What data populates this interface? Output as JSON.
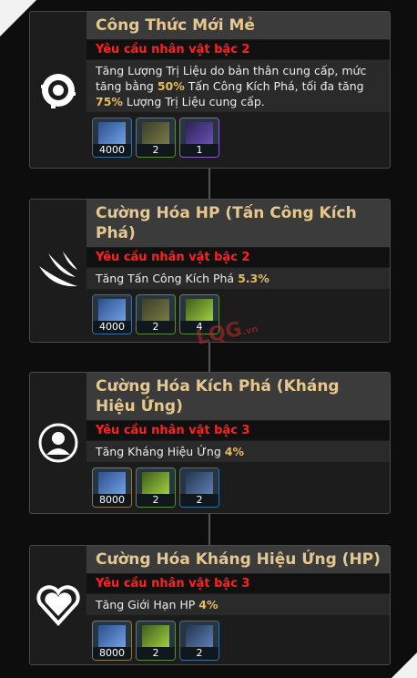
{
  "cards": [
    {
      "title": "Công Thức Mới Mẻ",
      "requirement": "Yêu cầu nhân vật bậc 2",
      "desc": {
        "t1": "Tăng Lượng Trị Liệu do bản thân cung cấp, mức tăng bằng ",
        "v1": "50%",
        "t2": " Tấn Công Kích Phá, tối đa tăng ",
        "v2": "75%",
        "t3": " Lượng Trị Liệu cung cấp."
      },
      "icon": "formula-icon",
      "items": [
        {
          "icon": "skill-book-icon",
          "count": "4000"
        },
        {
          "icon": "shell-material-icon",
          "count": "2"
        },
        {
          "icon": "crystal-material-icon",
          "count": "1"
        }
      ]
    },
    {
      "title": "Cường Hóa HP (Tấn Công Kích Phá)",
      "requirement": "Yêu cầu nhân vật bậc 2",
      "desc": {
        "t1": "Tăng Tấn Công Kích Phá ",
        "v1": "5.3%"
      },
      "icon": "claw-slash-icon",
      "items": [
        {
          "icon": "skill-book-icon",
          "count": "4000"
        },
        {
          "icon": "shell-material-icon",
          "count": "2"
        },
        {
          "icon": "green-shell-material-icon",
          "count": "4"
        }
      ]
    },
    {
      "title": "Cường Hóa Kích Phá (Kháng Hiệu Ứng)",
      "requirement": "Yêu cầu nhân vật bậc 3",
      "desc": {
        "t1": "Tăng Kháng Hiệu Ứng ",
        "v1": "4%"
      },
      "icon": "person-shield-icon",
      "items": [
        {
          "icon": "skill-book-icon",
          "count": "8000"
        },
        {
          "icon": "leaf-material-icon",
          "count": "2"
        },
        {
          "icon": "tools-material-icon",
          "count": "2"
        }
      ]
    },
    {
      "title": "Cường Hóa Kháng Hiệu Ứng (HP)",
      "requirement": "Yêu cầu nhân vật bậc 3",
      "desc": {
        "t1": "Tăng Giới Hạn HP ",
        "v1": "4%"
      },
      "icon": "heart-icon",
      "items": [
        {
          "icon": "skill-book-icon",
          "count": "8000"
        },
        {
          "icon": "leaf-material-icon",
          "count": "2"
        },
        {
          "icon": "tools-material-icon",
          "count": "2"
        }
      ]
    }
  ],
  "watermark": {
    "main": "LQG",
    "suffix": ".vn"
  },
  "colors": {
    "title_text": "#e6c88f",
    "requirement_text": "#ff2020",
    "highlight": "#e8bc5c"
  }
}
